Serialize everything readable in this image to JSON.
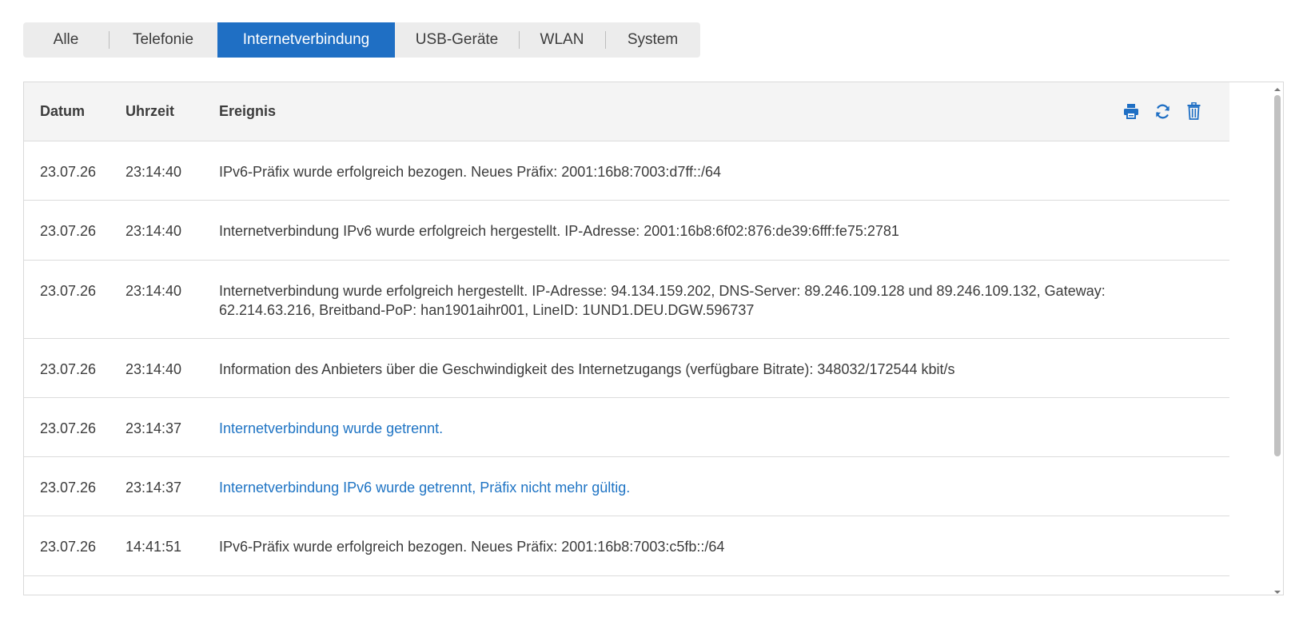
{
  "tabs": [
    {
      "label": "Alle"
    },
    {
      "label": "Telefonie"
    },
    {
      "label": "Internetverbindung",
      "active": true
    },
    {
      "label": "USB-Geräte"
    },
    {
      "label": "WLAN"
    },
    {
      "label": "System"
    }
  ],
  "table": {
    "headers": {
      "date": "Datum",
      "time": "Uhrzeit",
      "event": "Ereignis"
    },
    "actions": [
      {
        "icon": "print-icon"
      },
      {
        "icon": "refresh-icon"
      },
      {
        "icon": "trash-icon"
      }
    ],
    "rows": [
      {
        "date": "23.07.26",
        "time": "23:14:40",
        "event": "IPv6-Präfix wurde erfolgreich bezogen. Neues Präfix: 2001:16b8:7003:d7ff::/64",
        "highlight": false
      },
      {
        "date": "23.07.26",
        "time": "23:14:40",
        "event": "Internetverbindung IPv6 wurde erfolgreich hergestellt. IP-Adresse: 2001:16b8:6f02:876:de39:6fff:fe75:2781",
        "highlight": false
      },
      {
        "date": "23.07.26",
        "time": "23:14:40",
        "event": "Internetverbindung wurde erfolgreich hergestellt. IP-Adresse: 94.134.159.202, DNS-Server: 89.246.109.128 und 89.246.109.132, Gateway: 62.214.63.216, Breitband-PoP: han1901aihr001, LineID: 1UND1.DEU.DGW.596737",
        "highlight": false
      },
      {
        "date": "23.07.26",
        "time": "23:14:40",
        "event": "Information des Anbieters über die Geschwindigkeit des Internetzugangs (verfügbare Bitrate): 348032/172544 kbit/s",
        "highlight": false
      },
      {
        "date": "23.07.26",
        "time": "23:14:37",
        "event": "Internetverbindung wurde getrennt.",
        "highlight": true
      },
      {
        "date": "23.07.26",
        "time": "23:14:37",
        "event": "Internetverbindung IPv6 wurde getrennt, Präfix nicht mehr gültig.",
        "highlight": true
      },
      {
        "date": "23.07.26",
        "time": "14:41:51",
        "event": "IPv6-Präfix wurde erfolgreich bezogen. Neues Präfix: 2001:16b8:7003:c5fb::/64",
        "highlight": false
      }
    ]
  },
  "colors": {
    "accent": "#1f6fc4",
    "link": "#1f74c4"
  }
}
